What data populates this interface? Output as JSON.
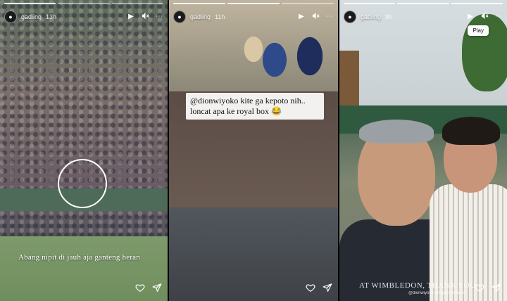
{
  "stories": [
    {
      "username": "gadiing",
      "time_ago": "13h",
      "caption": "Abang nipit di jauh aja ganteng heran"
    },
    {
      "username": "gadiing",
      "time_ago": "11h",
      "caption": "@dionwiyoko kite ga kepoto nih.. loncat apa ke royal box 😂"
    },
    {
      "username": "gadiing",
      "time_ago": "9h",
      "caption": "AT WIMBLEDON, THANK YOU",
      "tags": "@dionwiyoko @tapsindonesia"
    }
  ],
  "tooltip": "Play",
  "icons": {
    "play": "play-icon",
    "mute": "speaker-muted-icon",
    "more": "more-icon",
    "like": "heart-icon",
    "share": "send-icon"
  }
}
